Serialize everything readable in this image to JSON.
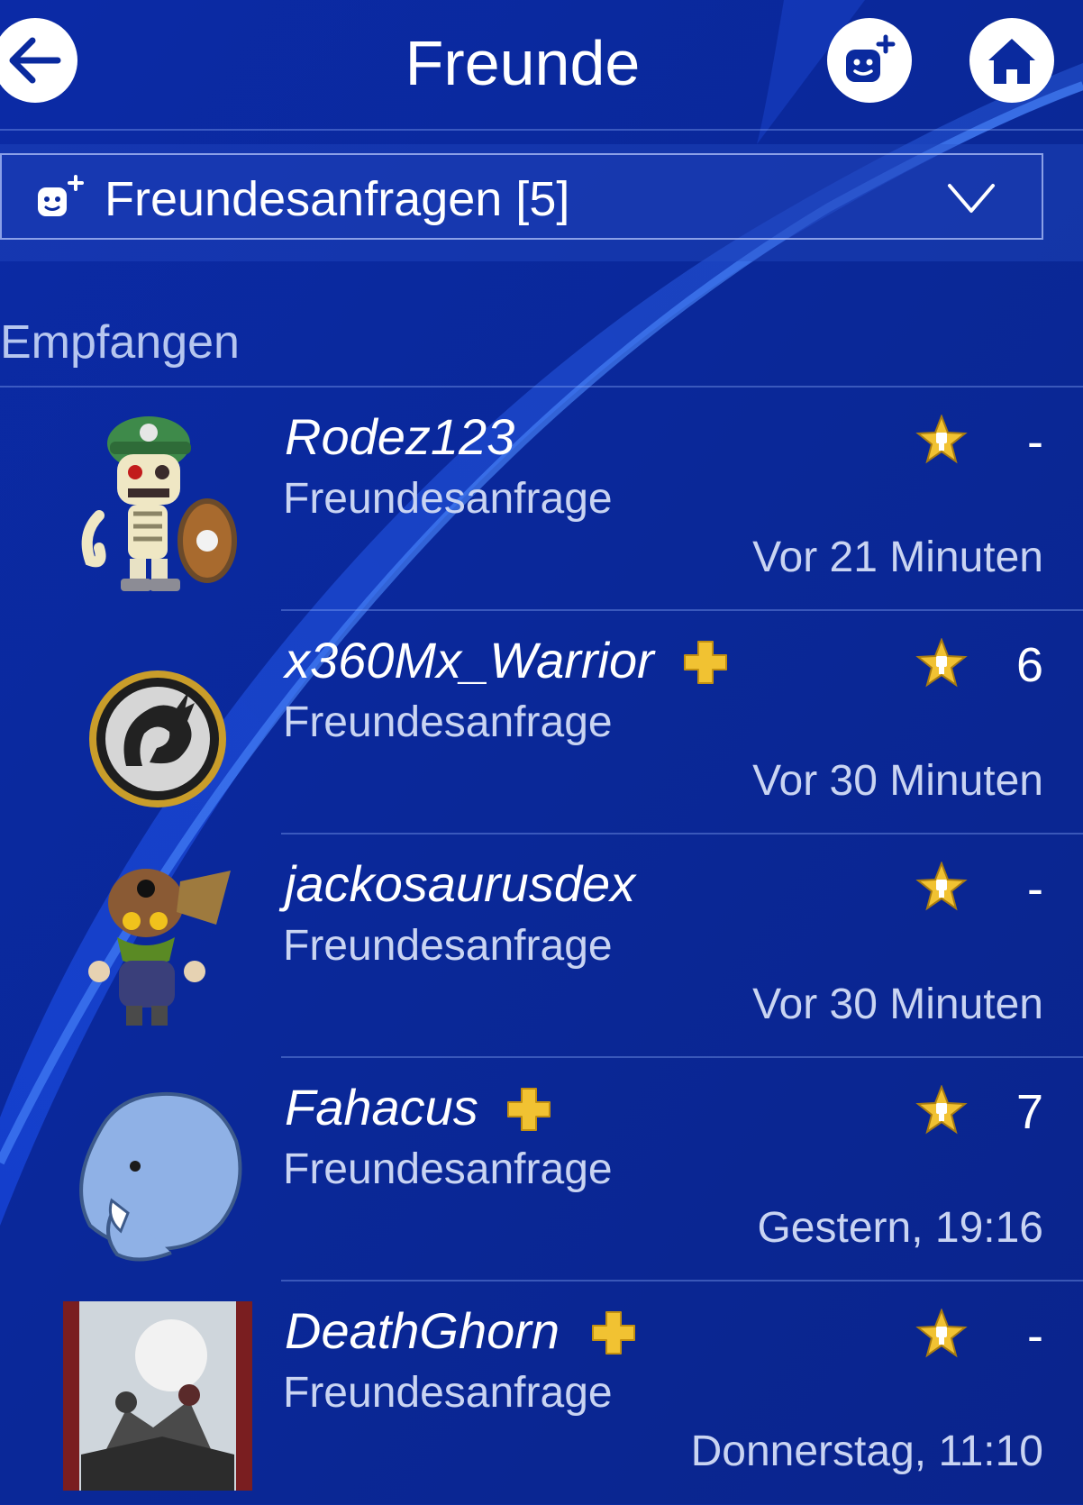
{
  "header": {
    "title": "Freunde"
  },
  "requests": {
    "label": "Freundesanfragen [5]"
  },
  "section": {
    "label": "Empfangen"
  },
  "friends": [
    {
      "name": "Rodez123",
      "subtitle": "Freundesanfrage",
      "time": "Vor 21 Minuten",
      "level": "-",
      "plus": false
    },
    {
      "name": "x360Mx_Warrior",
      "subtitle": "Freundesanfrage",
      "time": "Vor 30 Minuten",
      "level": "6",
      "plus": true
    },
    {
      "name": "jackosaurusdex",
      "subtitle": "Freundesanfrage",
      "time": "Vor 30 Minuten",
      "level": "-",
      "plus": false
    },
    {
      "name": "Fahacus",
      "subtitle": "Freundesanfrage",
      "time": "Gestern, 19:16",
      "level": "7",
      "plus": true
    },
    {
      "name": "DeathGhorn",
      "subtitle": "Freundesanfrage",
      "time": "Donnerstag, 11:10",
      "level": "-",
      "plus": true
    }
  ],
  "colors": {
    "background": "#0a2a9e",
    "accent": "#1f5cff",
    "gold": "#f1c232",
    "subtext": "#c9d4f2"
  },
  "icons": {
    "back": "arrow-left-icon",
    "add_friend": "add-friend-icon",
    "home": "home-icon",
    "chevron": "chevron-down-icon",
    "trophy": "trophy-icon",
    "plus": "ps-plus-icon"
  }
}
